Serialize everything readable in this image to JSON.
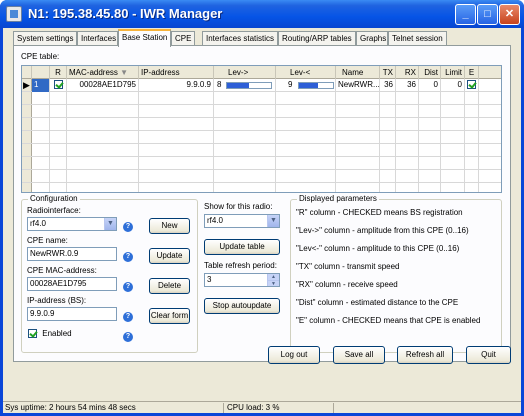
{
  "window": {
    "title": "N1: 195.38.45.80 - IWR Manager"
  },
  "tabs": [
    {
      "label": "System settings"
    },
    {
      "label": "Interfaces"
    },
    {
      "label": "Base Station"
    },
    {
      "label": "CPE"
    },
    {
      "label": "Interfaces statistics"
    },
    {
      "label": "Routing/ARP tables"
    },
    {
      "label": "Graphs"
    },
    {
      "label": "Telnet session"
    }
  ],
  "active_tab": "Base Station",
  "cpe_table": {
    "label": "CPE table:",
    "columns": [
      "R",
      "MAC-address",
      "IP-address",
      "Lev->",
      "Lev-<",
      "Name",
      "TX",
      "RX",
      "Dist",
      "Limit",
      "E"
    ],
    "rows": [
      {
        "id": "1",
        "r_checked": true,
        "mac": "00028AE1D795",
        "ip": "9.9.0.9",
        "lev_to": "8",
        "lev_to_level": 0.5,
        "lev_from": "9",
        "lev_from_level": 0.5625,
        "name": "NewRWR....",
        "tx": "36",
        "rx": "36",
        "dist": "0",
        "limit": "0",
        "e_checked": true
      }
    ]
  },
  "configuration": {
    "title": "Configuration",
    "radiointerface_label": "Radiointerface:",
    "radiointerface_value": "rf4.0",
    "cpe_name_label": "CPE name:",
    "cpe_name_value": "NewRWR.0.9",
    "cpe_mac_label": "CPE MAC-address:",
    "cpe_mac_value": "00028AE1D795",
    "ip_label": "IP-address (BS):",
    "ip_value": "9.9.0.9",
    "enabled_label": "Enabled",
    "enabled_checked": true,
    "buttons": {
      "new": "New",
      "update": "Update",
      "delete": "Delete",
      "clear_form": "Clear form"
    }
  },
  "show_panel": {
    "show_label": "Show for this radio:",
    "show_value": "rf4.0",
    "update_table": "Update table",
    "refresh_label": "Table refresh period:",
    "refresh_value": "3",
    "stop_autoupdate": "Stop autoupdate"
  },
  "displayed_parameters": {
    "title": "Displayed parameters",
    "lines": [
      "\"R\" column - CHECKED means BS registration",
      "\"Lev->\" column - amplitude from this CPE (0..16)",
      "\"Lev<-\" column - amplitude to this CPE (0..16)",
      "\"TX\" column - transmit speed",
      "\"RX\" column - receive speed",
      "\"Dist\" column - estimated distance to the CPE",
      "\"E\" column - CHECKED means  that CPE is enabled"
    ]
  },
  "bottom_buttons": {
    "log_out": "Log out",
    "save_all": "Save all",
    "refresh_all": "Refresh all",
    "quit": "Quit"
  },
  "statusbar": {
    "uptime": "Sys uptime: 2 hours 54 mins 48 secs",
    "cpu": "CPU load: 3 %"
  }
}
